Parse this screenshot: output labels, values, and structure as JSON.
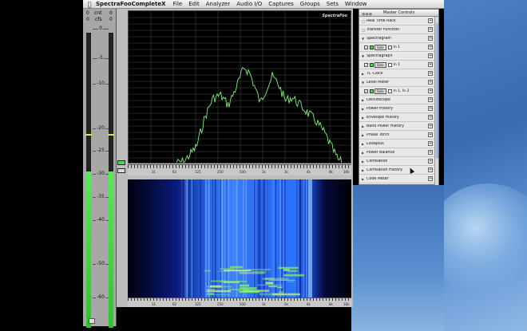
{
  "menubar": {
    "app_name": "SpectraFooCompleteX",
    "menus": [
      "File",
      "Edit",
      "Analyzer",
      "Audio I/O",
      "Captures",
      "Groups",
      "Sets",
      "Window"
    ]
  },
  "level_meter": {
    "header_left": "0",
    "header_mid": "cnt",
    "header_mid2": "cfs",
    "header_right": "0",
    "scale": [
      "0",
      "-5",
      "-10",
      "-20",
      "-25",
      "-30",
      "-35",
      "-40",
      "-50",
      "-60"
    ],
    "left_level": 0.53,
    "right_level": 0.53
  },
  "spectrograph": {
    "title": "SpectraFoo",
    "x_ticks": [
      "31",
      "62",
      "125",
      "250",
      "500",
      "1k",
      "2k",
      "4k",
      "8k",
      "16k"
    ]
  },
  "spectrogram": {
    "x_ticks": [
      "31",
      "62",
      "125",
      "250",
      "500",
      "1k",
      "2k",
      "4k",
      "8k",
      "16k"
    ]
  },
  "master_controls": {
    "title": "Master Controls",
    "rows": [
      {
        "label": "Real Time Rack",
        "kind": "top"
      },
      {
        "label": "Transfer Function",
        "kind": "top"
      },
      {
        "label": "Spectragram",
        "kind": "group"
      },
      {
        "label": "In 1",
        "kind": "sub",
        "solo": "Solo"
      },
      {
        "label": "Spectragraph",
        "kind": "group"
      },
      {
        "label": "In 1",
        "kind": "sub",
        "solo": "Solo"
      },
      {
        "label": "TC Clock",
        "kind": "item"
      },
      {
        "label": "Level Meter",
        "kind": "group"
      },
      {
        "label": "In 1, In 2",
        "kind": "sub",
        "solo": "Solo"
      },
      {
        "label": "Oscilloscope",
        "kind": "item"
      },
      {
        "label": "Power History",
        "kind": "item"
      },
      {
        "label": "Envelope History",
        "kind": "item"
      },
      {
        "label": "Band Power History",
        "kind": "item"
      },
      {
        "label": "Phase Torch",
        "kind": "item"
      },
      {
        "label": "Lissajous",
        "kind": "item"
      },
      {
        "label": "Power Balance",
        "kind": "item"
      },
      {
        "label": "Correlation",
        "kind": "item"
      },
      {
        "label": "Correlation History",
        "kind": "item"
      },
      {
        "label": "Code Meter",
        "kind": "item"
      }
    ]
  },
  "colors": {
    "trace": "#7cf07c",
    "meter": "#4ef04e",
    "spectrogram_blue": "#2e6fff"
  }
}
